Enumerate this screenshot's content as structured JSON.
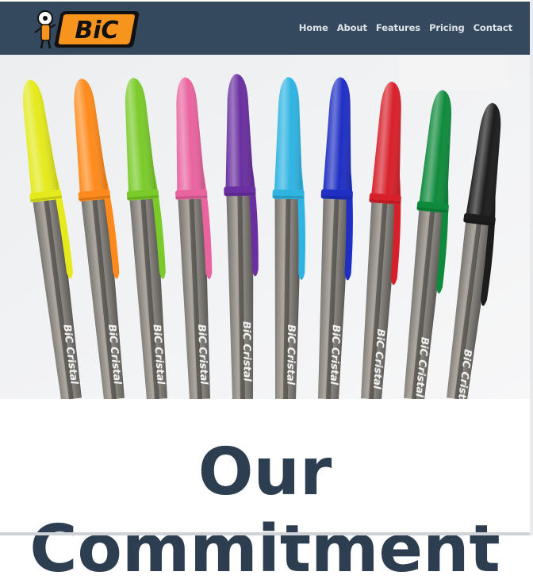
{
  "brand": {
    "logo_text": "BiC"
  },
  "nav": {
    "links": [
      {
        "label": "Home"
      },
      {
        "label": "About"
      },
      {
        "label": "Features"
      },
      {
        "label": "Pricing"
      },
      {
        "label": "Contact"
      }
    ]
  },
  "hero": {
    "pen_imprint": "BiC Cristal",
    "pens": [
      {
        "cap": "#e4ea1c"
      },
      {
        "cap": "#ff8a1c"
      },
      {
        "cap": "#7acb2a"
      },
      {
        "cap": "#e9649f"
      },
      {
        "cap": "#6a2fa0"
      },
      {
        "cap": "#2fb4e2"
      },
      {
        "cap": "#1f2fc4"
      },
      {
        "cap": "#d8202a"
      },
      {
        "cap": "#0f8a3c"
      },
      {
        "cap": "#1c1c1c"
      }
    ]
  },
  "section": {
    "title_line_1": "Our",
    "title_line_2": "Commitment"
  },
  "colors": {
    "nav_bg": "#34495e",
    "logo_orange": "#f7941d",
    "heading": "#2c3e50"
  }
}
